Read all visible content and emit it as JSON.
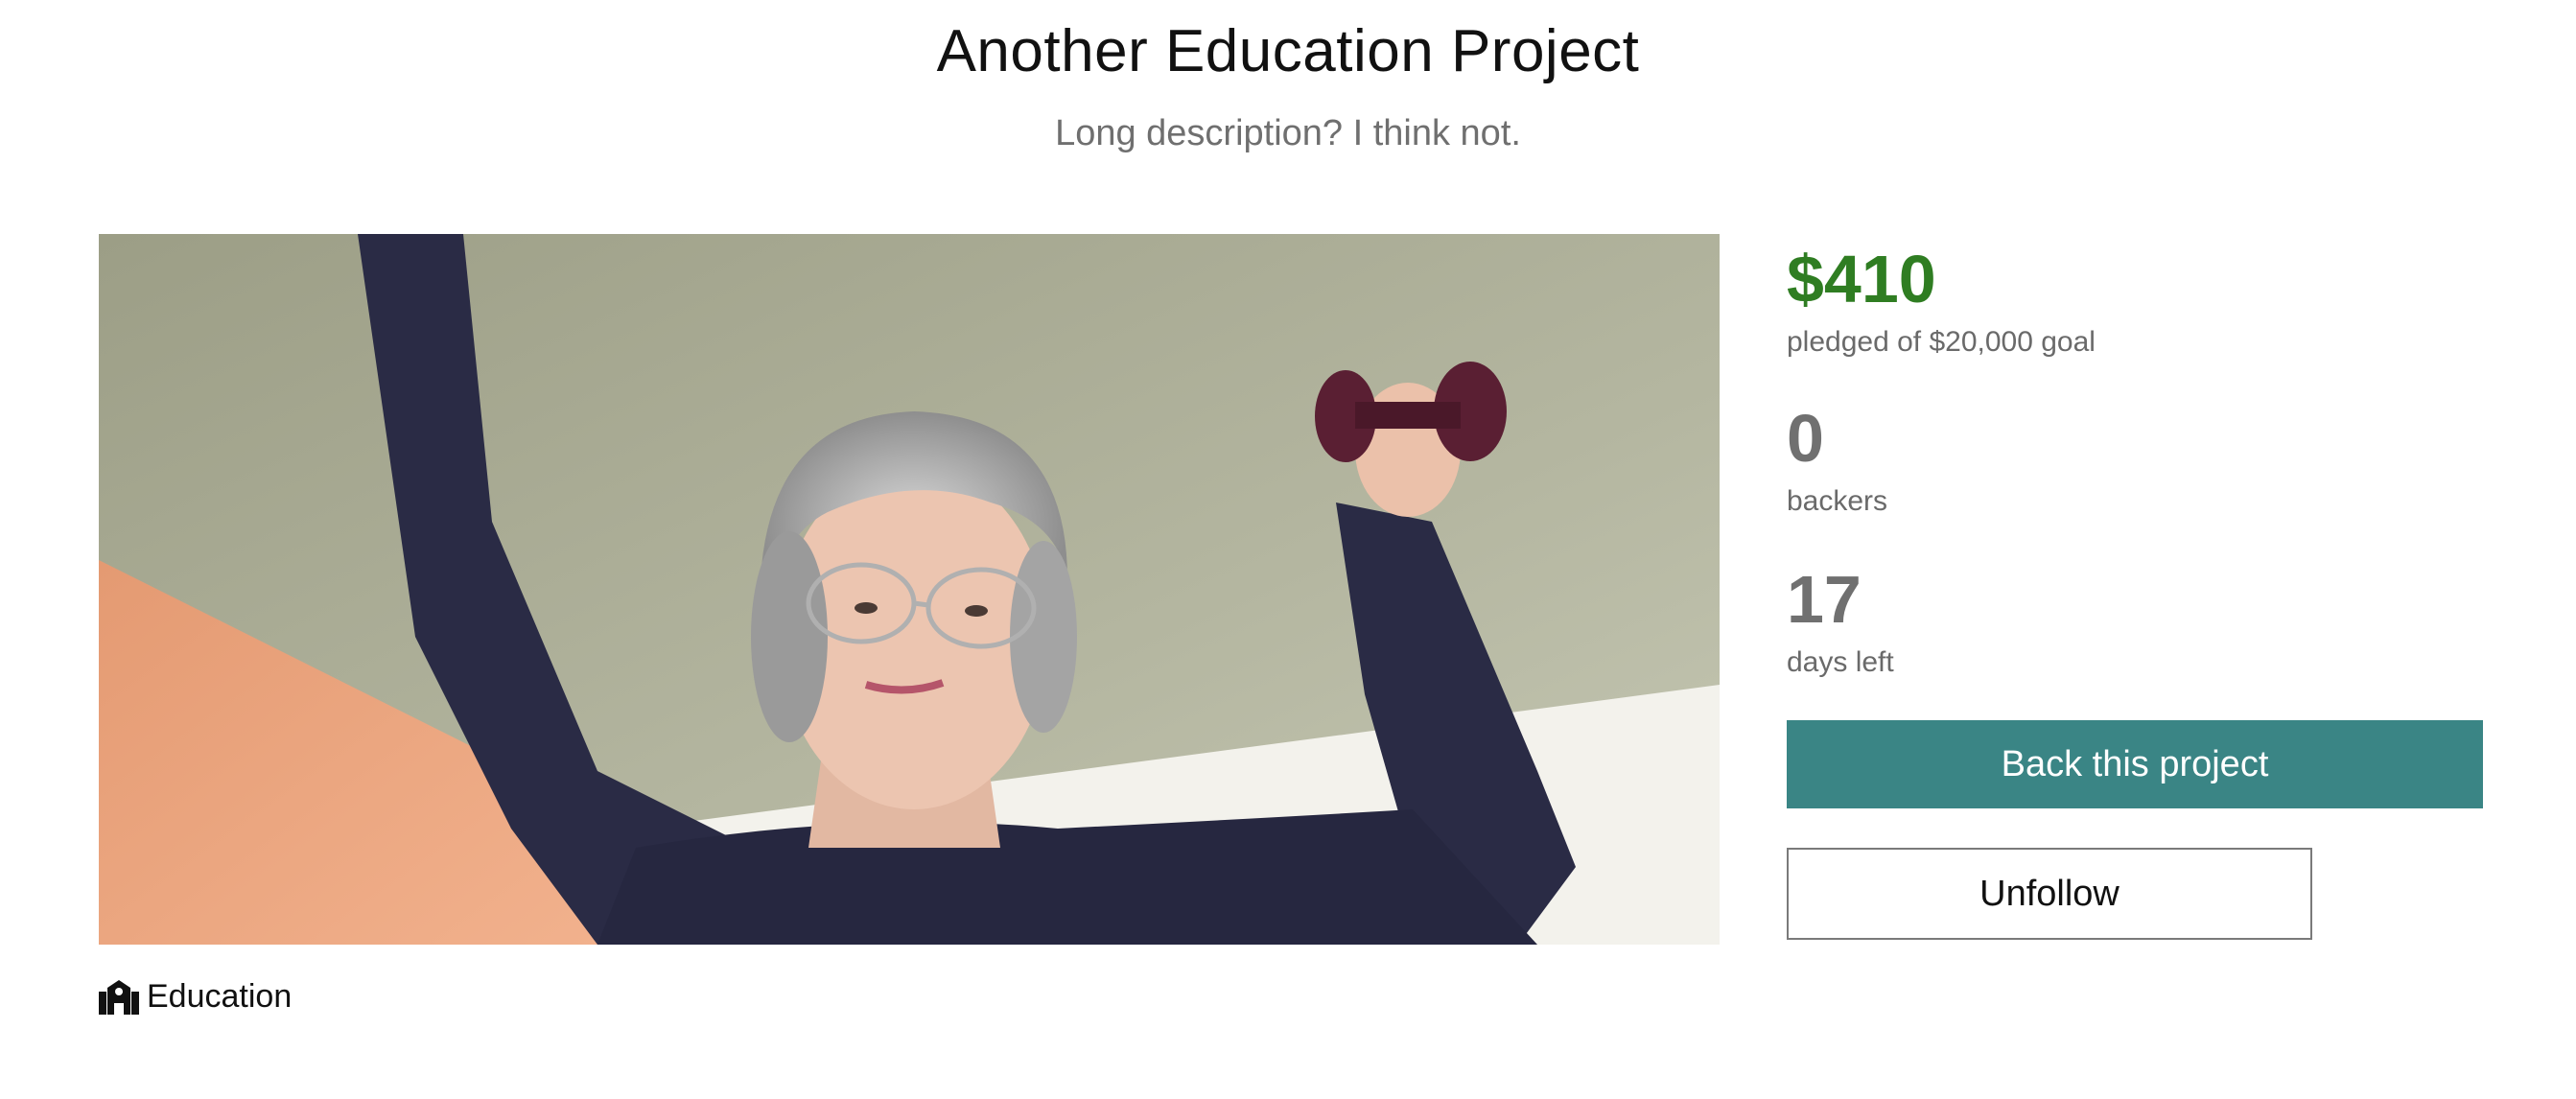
{
  "header": {
    "title": "Another Education Project",
    "subtitle": "Long description? I think not."
  },
  "hero": {
    "image_alt": "Elderly woman lifting a dumbbell"
  },
  "category": {
    "icon": "school-icon",
    "label": "Education"
  },
  "stats": {
    "pledged_amount": "$410",
    "pledged_label": "pledged of $20,000 goal",
    "backers_count": "0",
    "backers_label": "backers",
    "days_count": "17",
    "days_label": "days left"
  },
  "actions": {
    "back_label": "Back this project",
    "unfollow_label": "Unfollow"
  },
  "colors": {
    "money": "#2f7d22",
    "primary_button": "#3a8585"
  }
}
